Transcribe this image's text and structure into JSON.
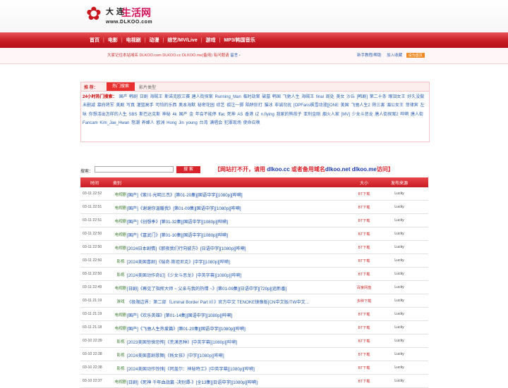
{
  "logo": {
    "mark": "✿",
    "cn": "大 连",
    "life": "生活网",
    "url": "www.DLKOO.com"
  },
  "nav": [
    "首页",
    "电影",
    "电视剧",
    "动漫",
    "综艺/MV/Live",
    "游戏",
    "MP3/韩国音乐"
  ],
  "notice": {
    "text": "大家记住本站域名 DLKOO.com DLKOO.cc DLKOO.me(备用) 有问题请",
    "link": "留言",
    "tail": "▪"
  },
  "toplinks": {
    "help": "新手教程/帮助",
    "fav": "加入收藏",
    "home": "设为首页"
  },
  "tagbox": {
    "label": "推 荐：",
    "tab_active": "热门搜索",
    "tab_other": "影片类型",
    "hot_label": "24小时热门搜索：",
    "tags": [
      "国产",
      "韩剧",
      "日剧",
      "海贼王",
      "斯诺克欧三赛",
      "唐人街探案",
      "Running_Man",
      "临时劫案",
      "破墓",
      "韩国",
      "飞驰人生",
      "海贼王 final",
      "周处",
      "美女",
      "沙丘",
      "[韩剧]",
      "第二十条",
      "眼泪女王",
      "好久没做",
      "未删减",
      "慕府将军",
      "美剧",
      "写真",
      "灌篮高手",
      "可怕的乐西",
      "奥本海默",
      "秘密花园",
      "综艺",
      "孤注一掷",
      "陷阱狂打",
      "猫冰",
      "非诚勿扰",
      "[OPFans枫雪动漫][ONE",
      "美国",
      "飞驰人生2",
      "除三害",
      "湄公女王",
      "菲律宾",
      "左咏",
      "你想活出怎样的人生",
      "SBS",
      "斯巴达克斯",
      "神秘",
      "4k",
      "国产 金",
      "年会不能停",
      "ffac",
      "死神",
      "AS",
      "香港",
      "IZ",
      "n.flying",
      "我家的熊孩子",
      "亚刑金刚",
      "烟火人家",
      "[MV]",
      "少女斗恶龙",
      "唐人街探案2",
      "哔嗬",
      "唐人街",
      "Fancam",
      "Kim_Jae_Hwan",
      "怒潮",
      "养蜂人",
      "欧洲",
      "Hong Jin young",
      "台湾",
      "满唱会",
      "犯罪现场",
      "使命召唤"
    ]
  },
  "search": {
    "label": "搜索：",
    "button": "搜 索",
    "warn_pre": "【网站打不开，请用 ",
    "d1": "dlkoo.cc",
    "warn_mid": " 或者备用域名",
    "d2": "dlkoo.net",
    "sp": " ",
    "d3": "dlkoo.me",
    "warn_post": "访问】"
  },
  "table": {
    "headers": [
      "时间",
      "类别",
      "",
      "大小",
      "发布来源"
    ],
    "rows": [
      {
        "time": "03-11 22:52",
        "cat": "电视剧",
        "title": "[国产]《紫川·光明三杰》[第01-20集][国语中字][1080p][哔嗬]",
        "size": "BT下载",
        "src": "Lucky"
      },
      {
        "time": "03-11 22:51",
        "cat": "电视剧",
        "title": "[国产]《谢谢你温暖我》[第01-09集][国语中字][1080p][哔嗬]",
        "size": "BT下载",
        "src": "Lucky"
      },
      {
        "time": "03-11 22:51",
        "cat": "电视剧",
        "title": "[国产]《创想季》[第01-32集][国语中字][1080p][哔嗬]",
        "size": "BT下载",
        "src": "Lucky"
      },
      {
        "time": "03-11 22:50",
        "cat": "电视剧",
        "title": "[国产]《富武门》[第01-10集][国语中字][1080p][哔嗬]",
        "size": "BT下载",
        "src": "Lucky"
      },
      {
        "time": "03-11 22:50",
        "cat": "电视剧",
        "title": "[2024日本剧情]《那夜我们行向彼方》[日语中字][1080p][哔嗬]",
        "size": "BT下载",
        "src": "Lucky"
      },
      {
        "time": "03-11 22:50",
        "cat": "影视",
        "title": "[2024美国喜剧]《瑞奇·斯坦尼克》[中字][1080p][哔嗬]",
        "size": "BT下载",
        "src": "Lucky"
      },
      {
        "time": "03-11 22:50",
        "cat": "影视",
        "title": "[2024美国动作奇幻]《少女斗恶龙》[中英字幕][1080p][哔嗬]",
        "size": "BT下载",
        "src": "Lucky"
      },
      {
        "time": "03-11 22:49",
        "cat": "电视剧",
        "title": "[日剧]《再见了指挥大师 ~ 父亲与我的热情 ~》[第01-09集][日语中字][720p][追新番]",
        "size": "百度网盘",
        "src": "Lucky"
      },
      {
        "time": "03-11 21:19",
        "cat": "游戏",
        "title": "《极限边界：第二部（Liminal Border Part II）》官方中文 TENOKE镜像版[CN中文版/TW中文...",
        "size": "多种下载",
        "src": "Lucky"
      },
      {
        "time": "03-11 21:19",
        "cat": "电视剧",
        "title": "[国产]《欢乐英雄》[第01-14集][国语中字][1080p][哔嗬]",
        "size": "BT下载",
        "src": "Lucky"
      },
      {
        "time": "03-11 21:18",
        "cat": "电视剧",
        "title": "[国产]《飞驰人生热爱篇》[第01-20集][国语中字][1080p][哔嗬]",
        "size": "BT下载",
        "src": "Lucky"
      },
      {
        "time": "03-10 22:39",
        "cat": "影视",
        "title": "[2023美国惊悚恐怖]《荒漠恶种》[中英字幕][1080p][哔嗬]",
        "size": "BT下载",
        "src": "Lucky"
      },
      {
        "time": "03-10 22:38",
        "cat": "影视",
        "title": "[2024美国喜剧歌舞]《贱女孩》[中字][1080p][哔嗬]",
        "size": "BT下载",
        "src": "Lucky"
      },
      {
        "time": "03-10 22:38",
        "cat": "影视",
        "title": "[2024美国动作惊悚]《阿盖尔：神秘特工》[中英字幕][1080p][哔嗬]",
        "size": "BT下载",
        "src": "Lucky"
      },
      {
        "time": "03-10 22:37",
        "cat": "电视剧",
        "title": "[日剧]《死神 千年血战篇 -决别谭-》[全13集][日语中字][1080p][哔嗬]",
        "size": "BT下载",
        "src": "Lucky"
      }
    ]
  }
}
